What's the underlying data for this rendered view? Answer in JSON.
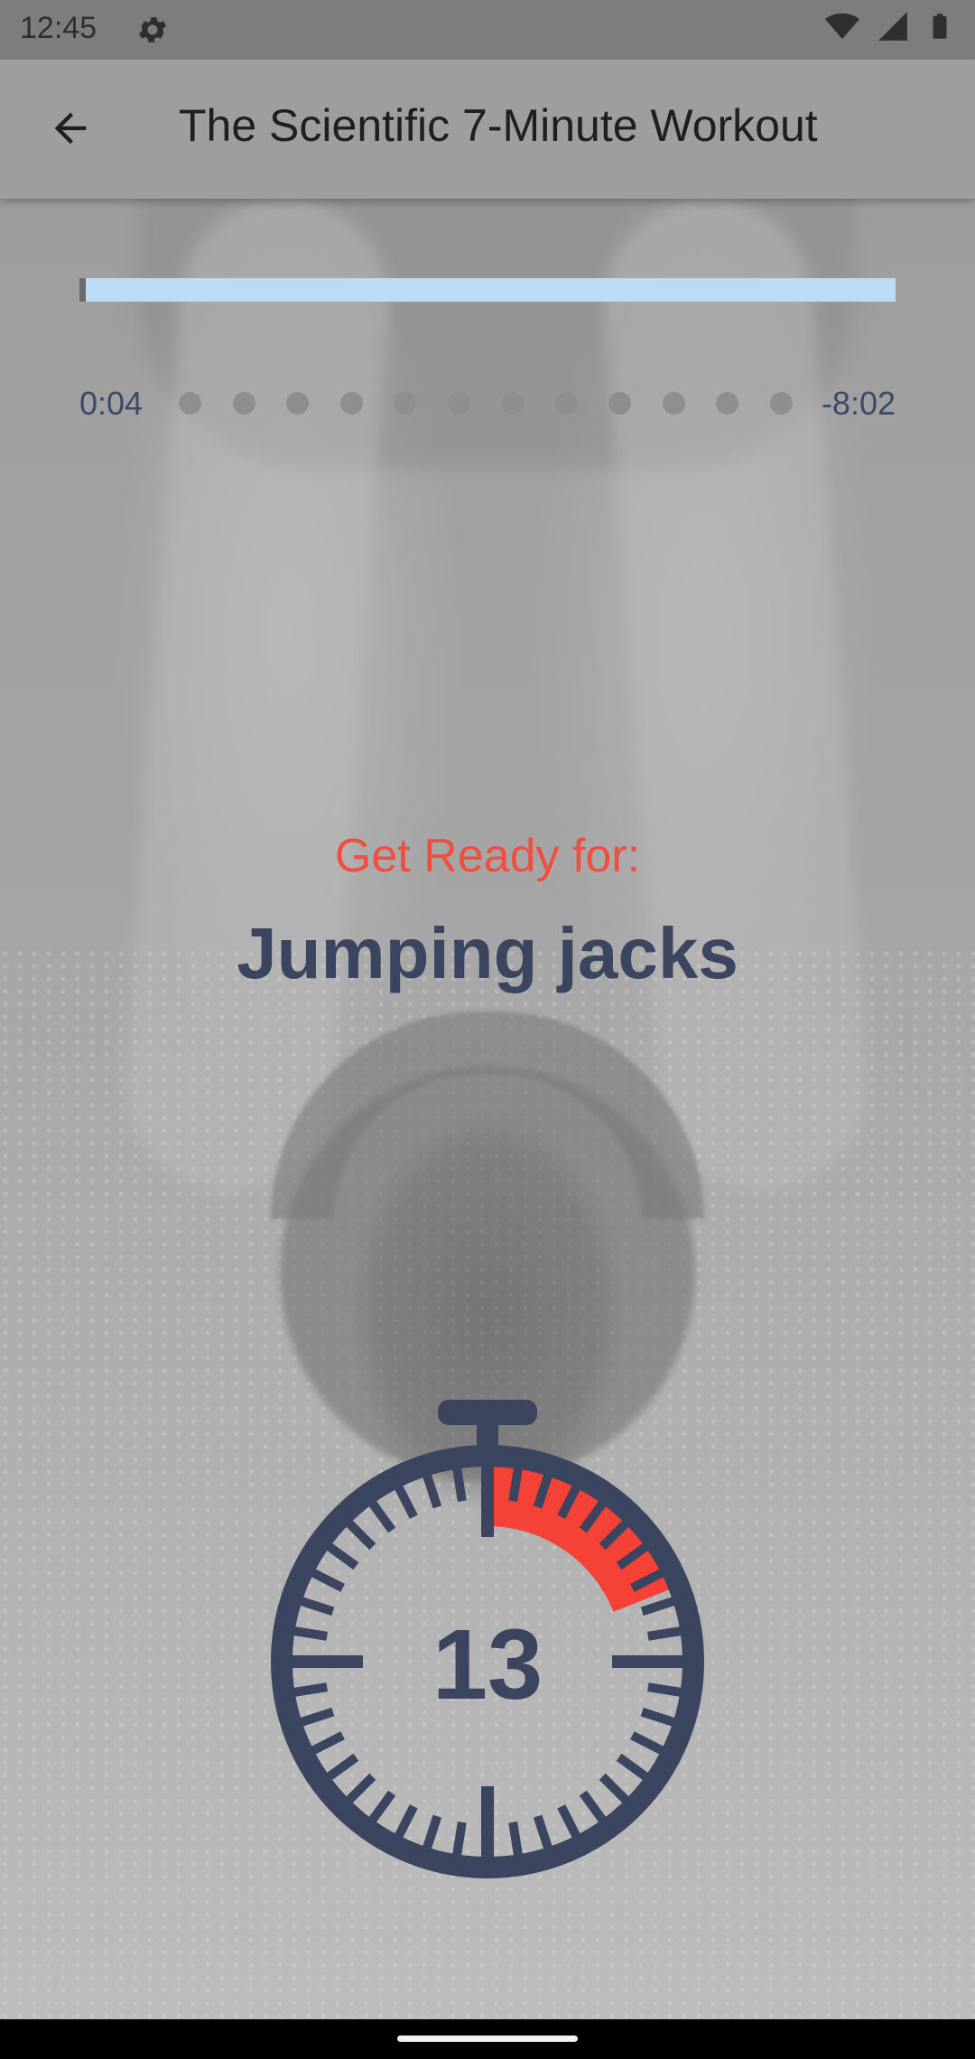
{
  "status_bar": {
    "time": "12:45",
    "icons": [
      "gear-icon",
      "wifi-icon",
      "signal-icon",
      "battery-icon"
    ]
  },
  "app_bar": {
    "back_icon": "arrow-back-icon",
    "title": "The Scientific 7-Minute Workout"
  },
  "workout_progress": {
    "elapsed": "0:04",
    "remaining": "-8:02",
    "fraction_complete": 0.008,
    "exercise_dots_count": 12,
    "colors": {
      "track": "#bcdcf6",
      "dots": "#8e8e8e"
    }
  },
  "get_ready": {
    "label": "Get Ready for:",
    "exercise_name": "Jumping jacks"
  },
  "countdown": {
    "seconds": "13",
    "fraction_elapsed": 0.19,
    "colors": {
      "dial": "#3b4560",
      "elapsed_arc": "#f44336"
    }
  },
  "colors": {
    "accent": "#f04e3e",
    "text_dark": "#3b4560"
  }
}
